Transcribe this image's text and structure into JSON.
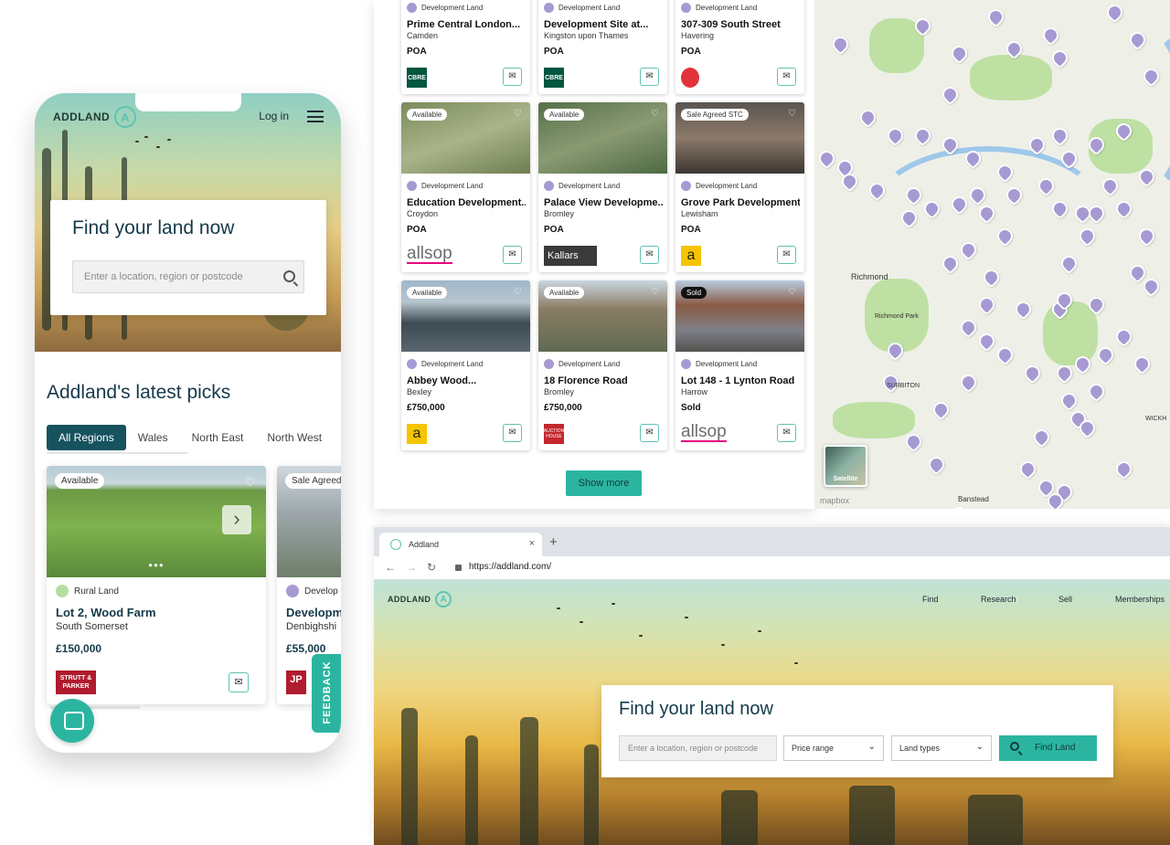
{
  "phone": {
    "logo_text": "ADDLAND",
    "login": "Log in",
    "hero_title": "Find your land now",
    "search_placeholder": "Enter a location, region or postcode",
    "picks_title": "Addland's latest picks",
    "tabs": [
      "All Regions",
      "Wales",
      "North East",
      "North West"
    ],
    "cards": [
      {
        "badge": "Available",
        "type": "Rural Land",
        "name": "Lot 2, Wood Farm",
        "location": "South Somerset",
        "price": "£150,000",
        "agent": "STRUTT & PARKER"
      },
      {
        "badge": "Sale Agreed",
        "type": "Develop",
        "name": "Developm",
        "location": "Denbighshi",
        "price": "£55,000",
        "agent": "JP"
      }
    ],
    "feedback": "FEEDBACK"
  },
  "listings": {
    "cards": [
      {
        "type": "Development Land",
        "name": "Prime Central London...",
        "location": "Camden",
        "price": "POA",
        "agent": "CBRE"
      },
      {
        "type": "Development Land",
        "name": "Development Site at...",
        "location": "Kingston upon Thames",
        "price": "POA",
        "agent": "CBRE"
      },
      {
        "type": "Development Land",
        "name": "307-309 South Street",
        "location": "Havering",
        "price": "POA",
        "agent": ""
      },
      {
        "badge": "Available",
        "type": "Development Land",
        "name": "Education Development...",
        "location": "Croydon",
        "price": "POA",
        "agent": "allsop"
      },
      {
        "badge": "Available",
        "type": "Development Land",
        "name": "Palace View Developme...",
        "location": "Bromley",
        "price": "POA",
        "agent": "Kallars"
      },
      {
        "badge": "Sale Agreed STC",
        "type": "Development Land",
        "name": "Grove Park Development...",
        "location": "Lewisham",
        "price": "POA",
        "agent": "a"
      },
      {
        "badge": "Available",
        "type": "Development Land",
        "name": "Abbey Wood...",
        "location": "Bexley",
        "price": "£750,000",
        "agent": "a"
      },
      {
        "badge": "Available",
        "type": "Development Land",
        "name": "18 Florence Road",
        "location": "Bromley",
        "price": "£750,000",
        "agent": "AUCTION HOUSE"
      },
      {
        "badge": "Sold",
        "type": "Development Land",
        "name": "Lot 148 - 1 Lynton Road",
        "location": "Harrow",
        "price": "Sold",
        "agent": "allsop"
      }
    ],
    "show_more": "Show more"
  },
  "map": {
    "labels": [
      "Richmond",
      "Richmond Park",
      "SURBITON",
      "Banstead",
      "WICKH"
    ],
    "satellite": "Satellite",
    "attribution": "mapbox"
  },
  "browser": {
    "tab_title": "Addland",
    "url": "https://addland.com/",
    "logo_text": "ADDLAND",
    "nav": [
      "Find",
      "Research",
      "Sell",
      "Memberships"
    ],
    "hero_title": "Find your land now",
    "search_placeholder": "Enter a location, region or postcode",
    "price_range": "Price range",
    "land_types": "Land types",
    "find_button": "Find Land"
  },
  "colors": {
    "teal": "#2bb5a0",
    "dark_teal": "#17525f",
    "pin": "#a79ad3"
  }
}
